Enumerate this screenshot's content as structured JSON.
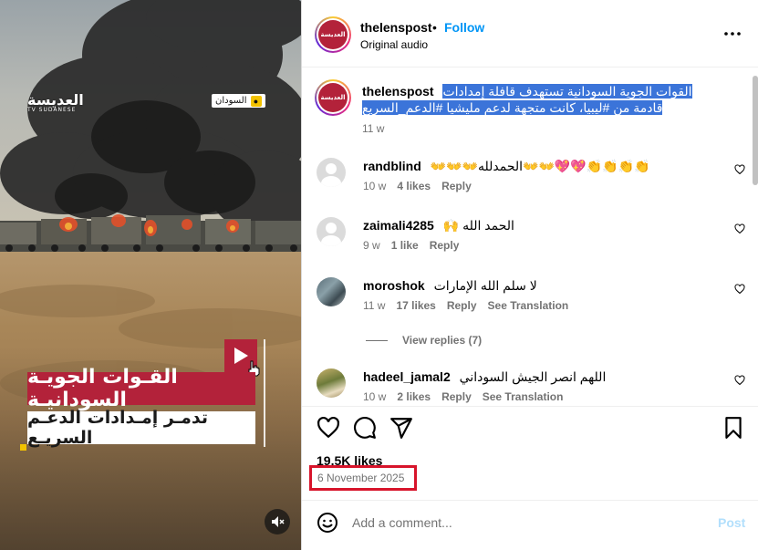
{
  "video": {
    "logo": "العديسة",
    "logo_sub": "TV SUDANESE",
    "country_tag": "السودان",
    "caption_line1": "القـوات الجويـة السودانيـة",
    "caption_line2": "تدمـر إمـدادات الدعـم السريـع",
    "play_icon": "play-icon",
    "mute_icon": "muted-speaker-icon"
  },
  "header": {
    "username": "thelenspost",
    "separator": "•",
    "follow_label": "Follow",
    "audio_label": "Original audio",
    "avatar_text": "العديسة",
    "more_icon": "more-horizontal-icon"
  },
  "caption": {
    "username": "thelenspost",
    "text": "القوات الجوية السودانية تستهدف قافلة إمدادات قادمة من #ليبيا، كانت متجهة لدعم مليشيا #الدعم_السريع",
    "time": "11 w"
  },
  "comments": [
    {
      "username": "randblind",
      "text": "👐👐👐الحمدلله👐👐💖💖👏👏👏👏",
      "time": "10 w",
      "likes": "4 likes",
      "reply": "Reply",
      "translate": ""
    },
    {
      "username": "zaimali4285",
      "text": "🙌 الحمد الله",
      "time": "9 w",
      "likes": "1 like",
      "reply": "Reply",
      "translate": ""
    },
    {
      "username": "moroshok",
      "text": "لا سلم الله الإمارات",
      "time": "11 w",
      "likes": "17 likes",
      "reply": "Reply",
      "translate": "See Translation"
    },
    {
      "username": "hadeel_jamal2",
      "text": "اللهم انصر الجيش السوداني",
      "time": "10 w",
      "likes": "2 likes",
      "reply": "Reply",
      "translate": "See Translation"
    }
  ],
  "view_replies": "View replies (7)",
  "actions": {
    "like_icon": "heart-icon",
    "comment_icon": "comment-icon",
    "share_icon": "share-icon",
    "save_icon": "bookmark-icon"
  },
  "likes_count": "19.5K likes",
  "date": "6 November 2025",
  "add_comment": {
    "placeholder": "Add a comment...",
    "post_label": "Post",
    "emoji_icon": "emoji-icon"
  },
  "colors": {
    "brand_red": "#b3223a",
    "link_blue": "#0095f6",
    "highlight_box": "#d7142b",
    "post_disabled": "#b2dffc"
  }
}
